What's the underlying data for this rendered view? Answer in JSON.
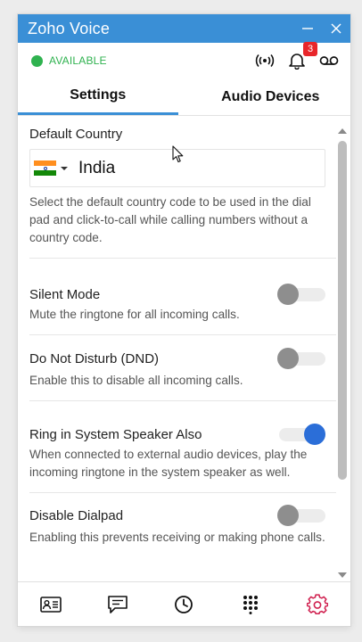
{
  "window": {
    "title": "Zoho Voice"
  },
  "status": {
    "text": "AVAILABLE",
    "color": "#2fb24f"
  },
  "header": {
    "notification_count": "3"
  },
  "tabs": [
    {
      "label": "Settings",
      "active": true
    },
    {
      "label": "Audio Devices",
      "active": false
    }
  ],
  "default_country": {
    "label": "Default Country",
    "value": "India",
    "description": "Select the default country code to be used in the dial pad and click-to-call while calling numbers without a country code."
  },
  "settings": [
    {
      "label": "Silent Mode",
      "description": "Mute the ringtone for all incoming calls.",
      "enabled": false
    },
    {
      "label": "Do Not Disturb (DND)",
      "description": "Enable this to disable all incoming calls.",
      "enabled": false
    },
    {
      "label": "Ring in System Speaker Also",
      "description": "When connected to external audio devices, play the incoming ringtone in the system speaker as well.",
      "enabled": true
    },
    {
      "label": "Disable Dialpad",
      "description": "Enabling this prevents receiving or making phone calls.",
      "enabled": false
    }
  ],
  "bottom_nav": [
    "contacts-icon",
    "messages-icon",
    "history-icon",
    "dialpad-icon",
    "settings-icon"
  ],
  "colors": {
    "accent": "#3a8fd6",
    "toggle_on": "#2b6ed8",
    "active_nav": "#d0204f"
  }
}
